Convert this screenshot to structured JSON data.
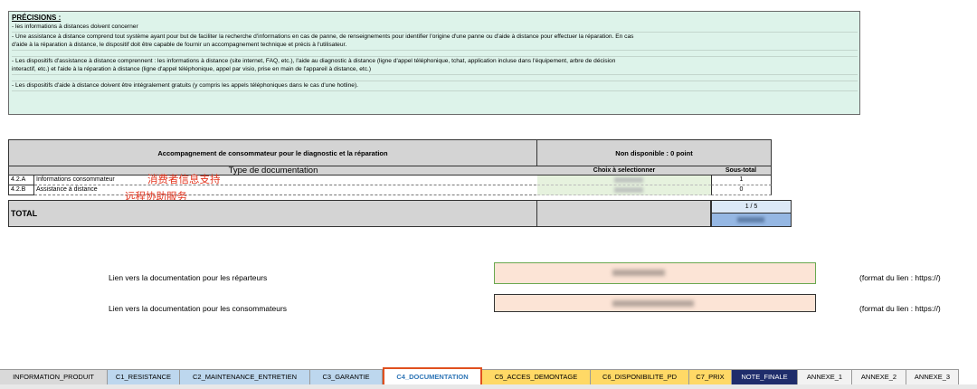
{
  "precisions": {
    "title": "PRÉCISIONS :",
    "lines": [
      "- les informations à distances doivent concerner",
      "- Une assistance à distance comprend tout système ayant pour but de faciliter la recherche d'informations en cas de panne, de renseignements pour identifier l'origine d'une panne ou d'aide à distance pour effectuer la réparation. En cas",
      "d'aide à la réparation à distance, le dispositif doit être capable de fournir un accompagnement technique et précis à l'utilisateur.",
      "- Les dispositifs d'assistance à distance comprennent : les informations à distance (site internet, FAQ, etc.), l'aide au diagnostic à distance (ligne d'appel téléphonique, tchat, application incluse dans l'équipement, arbre de décision",
      "interactif, etc.) et l'aide à la réparation à distance (ligne d'appel téléphonique, appel par visio, prise en main de l'appareil à distance, etc.)",
      "- Les dispositifs d'aide à distance doivent être intégralement gratuits (y compris les appels téléphoniques dans le cas d'une hotline)."
    ]
  },
  "table": {
    "header_main": "Accompagnement de consommateur pour le diagnostic et la réparation",
    "header_right": "Non disponible  : 0 point",
    "col_type": "Type de documentation",
    "col_choix": "Choix à selectionner",
    "col_subtotal": "Sous-total",
    "rows": [
      {
        "code": "4.2.A",
        "label": "Informations consommateur",
        "subtotal": "1",
        "annotation": "消费者信息支持"
      },
      {
        "code": "4.2.B",
        "label": "Assistance à distance",
        "subtotal": "0",
        "annotation": "远程协助服务"
      }
    ],
    "total_label": "TOTAL",
    "total_score": "1 / 5"
  },
  "links": [
    {
      "label": "Lien vers la documentation pour les réparteurs",
      "hint": "(format du lien : https://)"
    },
    {
      "label": "Lien vers la documentation pour les consommateurs",
      "hint": "(format du lien : https://)"
    }
  ],
  "tabs": [
    {
      "label": "INFORMATION_PRODUIT",
      "color": "#d9d9d9",
      "text": "#000000"
    },
    {
      "label": "C1_RESISTANCE",
      "color": "#bdd7ee",
      "text": "#000000"
    },
    {
      "label": "C2_MAINTENANCE_ENTRETIEN",
      "color": "#bdd7ee",
      "text": "#000000"
    },
    {
      "label": "C3_GARANTIE",
      "color": "#bdd7ee",
      "text": "#000000"
    },
    {
      "label": "C4_DOCUMENTATION",
      "color": "#ffffff",
      "text": "#2e75b6"
    },
    {
      "label": "C5_ACCES_DEMONTAGE",
      "color": "#ffd966",
      "text": "#000000"
    },
    {
      "label": "C6_DISPONIBILITE_PD",
      "color": "#ffd966",
      "text": "#000000"
    },
    {
      "label": "C7_PRIX",
      "color": "#ffd966",
      "text": "#000000"
    },
    {
      "label": "NOTE_FINALE",
      "color": "#1f2d6b",
      "text": "#ffffff"
    },
    {
      "label": "ANNEXE_1",
      "color": "#f2f2f2",
      "text": "#000000"
    },
    {
      "label": "ANNEXE_2",
      "color": "#f2f2f2",
      "text": "#000000"
    },
    {
      "label": "ANNEXE_3",
      "color": "#f2f2f2",
      "text": "#000000"
    }
  ],
  "active_tab": "C4_DOCUMENTATION"
}
